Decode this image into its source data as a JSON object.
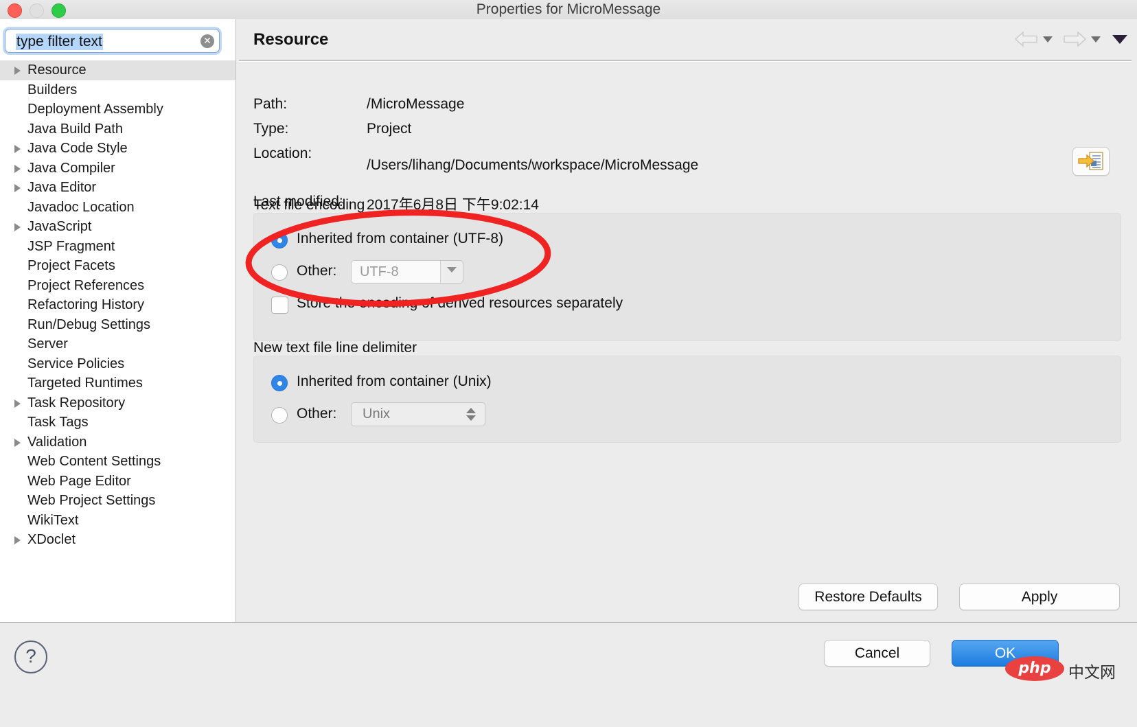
{
  "window": {
    "title": "Properties for MicroMessage",
    "traffic_lights": [
      "close",
      "minimize",
      "zoom"
    ]
  },
  "sidebar": {
    "filter": {
      "value": "type filter text",
      "placeholder": "type filter text",
      "clear_icon": "clear-icon"
    },
    "items": [
      {
        "label": "Resource",
        "expandable": true,
        "selected": true
      },
      {
        "label": "Builders",
        "expandable": false,
        "selected": false
      },
      {
        "label": "Deployment Assembly",
        "expandable": false,
        "selected": false
      },
      {
        "label": "Java Build Path",
        "expandable": false,
        "selected": false
      },
      {
        "label": "Java Code Style",
        "expandable": true,
        "selected": false
      },
      {
        "label": "Java Compiler",
        "expandable": true,
        "selected": false
      },
      {
        "label": "Java Editor",
        "expandable": true,
        "selected": false
      },
      {
        "label": "Javadoc Location",
        "expandable": false,
        "selected": false
      },
      {
        "label": "JavaScript",
        "expandable": true,
        "selected": false
      },
      {
        "label": "JSP Fragment",
        "expandable": false,
        "selected": false
      },
      {
        "label": "Project Facets",
        "expandable": false,
        "selected": false
      },
      {
        "label": "Project References",
        "expandable": false,
        "selected": false
      },
      {
        "label": "Refactoring History",
        "expandable": false,
        "selected": false
      },
      {
        "label": "Run/Debug Settings",
        "expandable": false,
        "selected": false
      },
      {
        "label": "Server",
        "expandable": false,
        "selected": false
      },
      {
        "label": "Service Policies",
        "expandable": false,
        "selected": false
      },
      {
        "label": "Targeted Runtimes",
        "expandable": false,
        "selected": false
      },
      {
        "label": "Task Repository",
        "expandable": true,
        "selected": false
      },
      {
        "label": "Task Tags",
        "expandable": false,
        "selected": false
      },
      {
        "label": "Validation",
        "expandable": true,
        "selected": false
      },
      {
        "label": "Web Content Settings",
        "expandable": false,
        "selected": false
      },
      {
        "label": "Web Page Editor",
        "expandable": false,
        "selected": false
      },
      {
        "label": "Web Project Settings",
        "expandable": false,
        "selected": false
      },
      {
        "label": "WikiText",
        "expandable": false,
        "selected": false
      },
      {
        "label": "XDoclet",
        "expandable": true,
        "selected": false
      }
    ]
  },
  "page": {
    "title": "Resource",
    "nav": {
      "back_icon": "back-arrow-icon",
      "back_caret_icon": "chevron-down-icon",
      "forward_icon": "forward-arrow-icon",
      "forward_caret_icon": "chevron-down-icon",
      "menu_icon": "triangle-down-icon"
    },
    "info": {
      "path_label": "Path:",
      "path_value": "/MicroMessage",
      "type_label": "Type:",
      "type_value": "Project",
      "location_label": "Location:",
      "location_value": "/Users/lihang/Documents/workspace/MicroMessage",
      "reveal_icon": "reveal-in-explorer-icon",
      "last_modified_label": "Last modified:",
      "last_modified_value": "2017年6月8日 下午9:02:14"
    },
    "encoding": {
      "group_label": "Text file encoding",
      "inherited_label": "Inherited from container (UTF-8)",
      "inherited_selected": true,
      "other_label": "Other:",
      "other_selected": false,
      "other_value": "UTF-8",
      "other_caret_icon": "chevron-down-icon",
      "store_separately_label": "Store the encoding of derived resources separately",
      "store_separately_checked": false
    },
    "delimiter": {
      "group_label": "New text file line delimiter",
      "inherited_label": "Inherited from container (Unix)",
      "inherited_selected": true,
      "other_label": "Other:",
      "other_selected": false,
      "other_value": "Unix",
      "stepper_icon": "stepper-up-down-icon"
    },
    "buttons": {
      "restore_defaults": "Restore Defaults",
      "apply": "Apply"
    }
  },
  "footer": {
    "help_label": "?",
    "cancel": "Cancel",
    "ok": "OK"
  },
  "annotation": {
    "shape": "red-ellipse-highlight",
    "color": "#f02323",
    "target": "text-file-encoding-radio-group"
  },
  "watermark": {
    "badge": "php",
    "text": "中文网"
  }
}
